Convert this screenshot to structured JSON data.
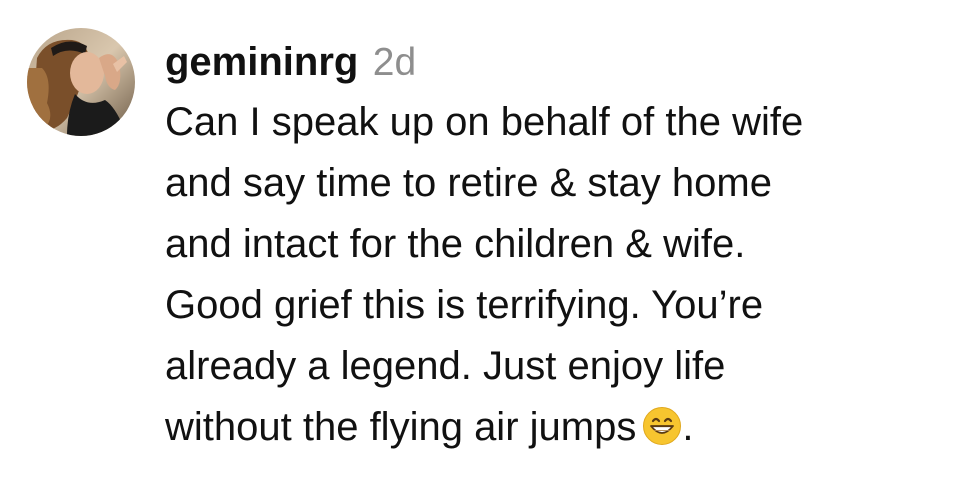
{
  "comment": {
    "username": "gemininrg",
    "age": "2d",
    "text_lines": [
      "Can I speak up on behalf of the wife",
      "and say time to retire & stay home",
      "and intact for the children & wife.",
      "Good grief this is terrifying. You’re",
      "already a legend. Just enjoy life",
      "without the flying air jumps"
    ],
    "text_end": ".",
    "emoji": "grinning-face-with-smiling-eyes-icon"
  }
}
